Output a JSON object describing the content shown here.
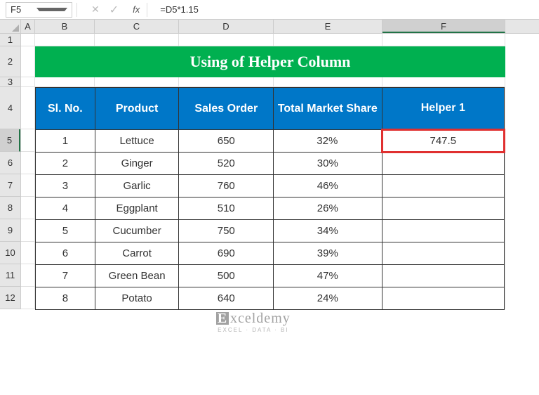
{
  "nameBox": "F5",
  "formula": "=D5*1.15",
  "columns": [
    "A",
    "B",
    "C",
    "D",
    "E",
    "F"
  ],
  "rows": [
    "1",
    "2",
    "3",
    "4",
    "5",
    "6",
    "7",
    "8",
    "9",
    "10",
    "11",
    "12"
  ],
  "selectedCol": "F",
  "selectedRow": "5",
  "title": "Using of Helper Column",
  "headers": {
    "sl": "Sl. No.",
    "product": "Product",
    "sales": "Sales Order",
    "share": "Total Market Share",
    "helper": "Helper 1"
  },
  "tableRows": [
    {
      "sl": "1",
      "product": "Lettuce",
      "sales": "650",
      "share": "32%",
      "helper": "747.5"
    },
    {
      "sl": "2",
      "product": "Ginger",
      "sales": "520",
      "share": "30%",
      "helper": ""
    },
    {
      "sl": "3",
      "product": "Garlic",
      "sales": "760",
      "share": "46%",
      "helper": ""
    },
    {
      "sl": "4",
      "product": "Eggplant",
      "sales": "510",
      "share": "26%",
      "helper": ""
    },
    {
      "sl": "5",
      "product": "Cucumber",
      "sales": "750",
      "share": "34%",
      "helper": ""
    },
    {
      "sl": "6",
      "product": "Carrot",
      "sales": "690",
      "share": "39%",
      "helper": ""
    },
    {
      "sl": "7",
      "product": "Green Bean",
      "sales": "500",
      "share": "47%",
      "helper": ""
    },
    {
      "sl": "8",
      "product": "Potato",
      "sales": "640",
      "share": "24%",
      "helper": ""
    }
  ],
  "watermark": {
    "main": "xceldemy",
    "sub": "EXCEL · DATA · BI"
  }
}
